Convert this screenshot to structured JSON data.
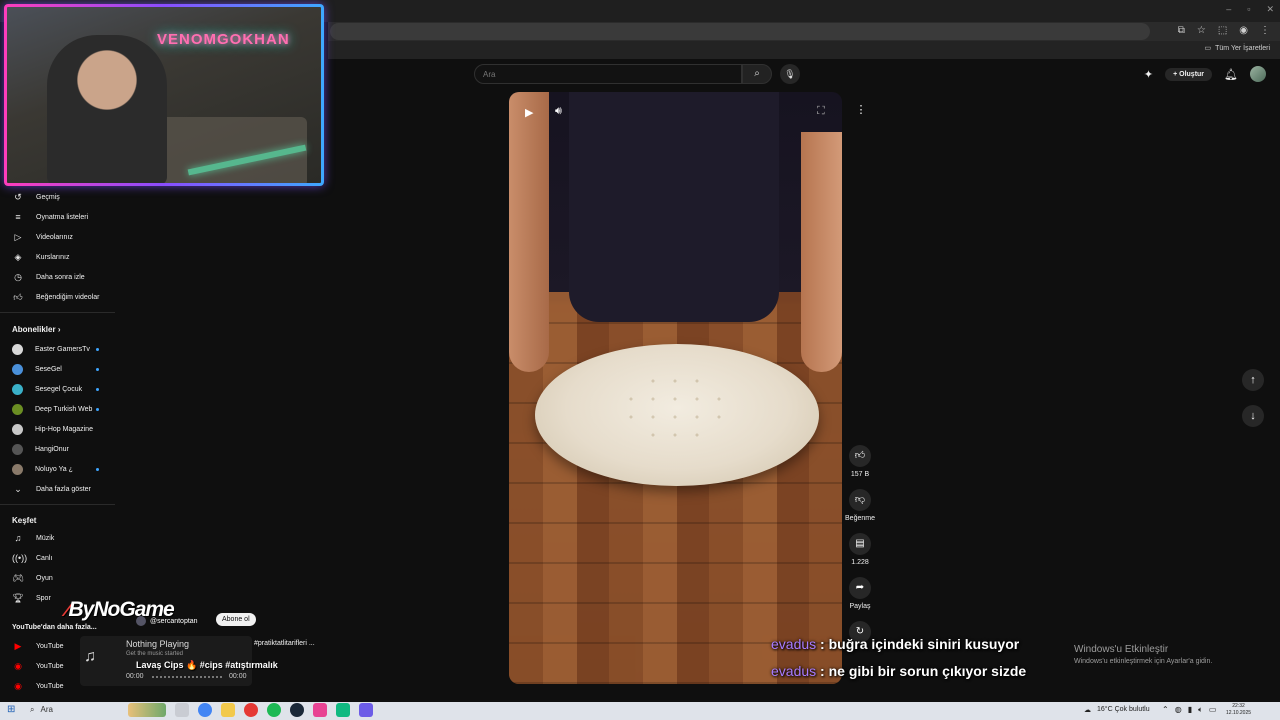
{
  "browser": {
    "window_controls": [
      "–",
      "▫",
      "✕"
    ],
    "bookmarks_all": "Tüm Yer İşaretleri"
  },
  "header": {
    "search_placeholder": "Ara",
    "create_label": "Oluştur"
  },
  "webcam": {
    "neon_sign": "VENOMGOKHAN"
  },
  "sidebar": {
    "you_items": [
      {
        "label": "Geçmiş",
        "icon": "history-icon"
      },
      {
        "label": "Oynatma listeleri",
        "icon": "playlist-icon"
      },
      {
        "label": "Videolarınız",
        "icon": "your-videos-icon"
      },
      {
        "label": "Kurslarınız",
        "icon": "courses-icon"
      },
      {
        "label": "Daha sonra izle",
        "icon": "watch-later-icon"
      },
      {
        "label": "Beğendiğim videolar",
        "icon": "liked-icon"
      }
    ],
    "subscriptions_title": "Abonelikler",
    "subscriptions": [
      {
        "label": "Easter GamersTv",
        "color": "#d8d8d8",
        "live_dot": true
      },
      {
        "label": "SeseGel",
        "color": "#4a90d9",
        "live_dot": true
      },
      {
        "label": "Sesegel Çocuk",
        "color": "#3ab0c8",
        "live_dot": true
      },
      {
        "label": "Deep Turkish Web",
        "color": "#6b8e23",
        "live_dot": true
      },
      {
        "label": "Hip-Hop Magazine",
        "color": "#c8c8c8",
        "live_dot": false
      },
      {
        "label": "HangiOnur",
        "color": "#555555",
        "live_dot": false
      },
      {
        "label": "Noluyo Ya ¿",
        "color": "#8a7a6a",
        "live_dot": true
      }
    ],
    "show_more": "Daha fazla göster",
    "explore_title": "Keşfet",
    "explore_items": [
      {
        "label": "Müzik",
        "icon": "music-icon"
      },
      {
        "label": "Canlı",
        "icon": "live-icon"
      },
      {
        "label": "Oyun",
        "icon": "gaming-icon"
      },
      {
        "label": "Spor",
        "icon": "sports-icon"
      }
    ],
    "more_from_youtube": "YouTube'dan daha fazla...",
    "youtube_items": [
      "YouTube",
      "YouTube",
      "YouTube"
    ]
  },
  "short": {
    "likes": "157 B",
    "dislike_label": "Beğenme",
    "comments": "1.228",
    "share_label": "Paylaş",
    "channel": "@sercantoptan",
    "subscribe": "Abone ol",
    "title": "Lavaş Cips 🔥 #cips #atıştırmalık",
    "hashtags": "#pratiktatlitarifleri ..."
  },
  "overlay": {
    "logo": "ByNoGame",
    "music_title": "Nothing Playing",
    "music_sub": "Get the music started",
    "time_start": "00:00",
    "time_end": "00:00"
  },
  "chat": [
    {
      "user": "evadus",
      "message": ": buğra içindeki siniri kusuyor"
    },
    {
      "user": "evadus",
      "message": ": ne gibi bir sorun çıkıyor sizde"
    }
  ],
  "windows_activation": {
    "title": "Windows'u Etkinleştir",
    "subtitle": "Windows'u etkinleştirmek için Ayarlar'a gidin."
  },
  "taskbar": {
    "search": "Ara",
    "weather": "16°C  Çok bulutlu",
    "time": "22:32",
    "date": "12.10.2025"
  }
}
